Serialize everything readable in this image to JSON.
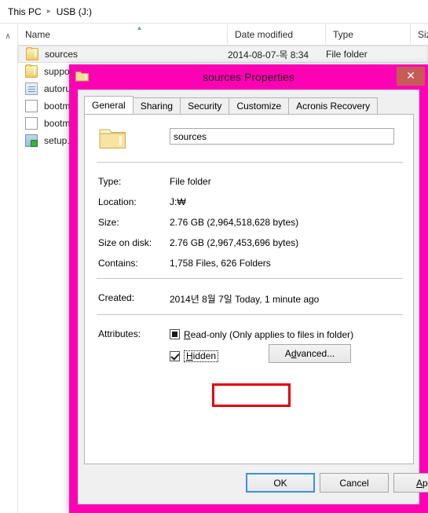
{
  "explorer": {
    "breadcrumb": {
      "root": "This PC",
      "separator": "▸",
      "current": "USB (J:)"
    },
    "columns": [
      {
        "key": "name",
        "label": "Name"
      },
      {
        "key": "date",
        "label": "Date modified"
      },
      {
        "key": "type",
        "label": "Type"
      },
      {
        "key": "size",
        "label": "Siz"
      }
    ],
    "sort": {
      "column": "Name",
      "direction": "ascending",
      "glyph": "▲"
    },
    "nav_scroll_up_glyph": "∧",
    "files": [
      {
        "name": "sources",
        "icon": "folder-icon",
        "date": "2014-08-07-목 8:34",
        "type": "File folder",
        "selected": true
      },
      {
        "name": "suppo",
        "icon": "folder-icon",
        "date": "",
        "type": "",
        "selected": false
      },
      {
        "name": "autoru",
        "icon": "inf-file-icon",
        "date": "",
        "type": "",
        "selected": false
      },
      {
        "name": "bootm",
        "icon": "document-icon",
        "date": "",
        "type": "",
        "selected": false
      },
      {
        "name": "bootm",
        "icon": "document-icon",
        "date": "",
        "type": "",
        "selected": false
      },
      {
        "name": "setup.",
        "icon": "executable-icon",
        "date": "",
        "type": "",
        "selected": false
      }
    ]
  },
  "dialog": {
    "title": "sources Properties",
    "close_glyph": "✕",
    "frame_color": "#ff00b4",
    "close_button_color": "#c75b57",
    "tabs": [
      {
        "label": "General",
        "active": true
      },
      {
        "label": "Sharing",
        "active": false
      },
      {
        "label": "Security",
        "active": false
      },
      {
        "label": "Customize",
        "active": false
      },
      {
        "label": "Acronis Recovery",
        "active": false
      }
    ],
    "name_field": {
      "value": "sources",
      "placeholder": ""
    },
    "details": [
      {
        "label": "Type:",
        "value": "File folder"
      },
      {
        "label": "Location:",
        "value": "J:₩"
      },
      {
        "label": "Size:",
        "value": "2.76 GB (2,964,518,628 bytes)"
      },
      {
        "label": "Size on disk:",
        "value": "2.76 GB (2,967,453,696 bytes)"
      },
      {
        "label": "Contains:",
        "value": "1,758 Files, 626 Folders"
      }
    ],
    "created": {
      "label": "Created:",
      "value": "2014년 8월 7일 Today, 1 minute ago"
    },
    "attributes": {
      "label": "Attributes:",
      "read_only": {
        "text_prefix": "R",
        "text_rest": "ead-only (Only applies to files in folder)",
        "state": "mixed"
      },
      "hidden": {
        "text_prefix": "H",
        "text_rest": "idden",
        "state": "checked",
        "focused": true,
        "highlight_color": "#e50000"
      },
      "advanced_button": {
        "text_prefix_before": "A",
        "text_mnemonic": "d",
        "text_rest": "vanced..."
      }
    },
    "buttons": [
      {
        "name": "ok",
        "label": "OK",
        "default": true
      },
      {
        "name": "cancel",
        "label": "Cancel",
        "default": false
      },
      {
        "name": "apply",
        "label": "Apply",
        "default": false,
        "mnemonic": "A"
      }
    ]
  }
}
